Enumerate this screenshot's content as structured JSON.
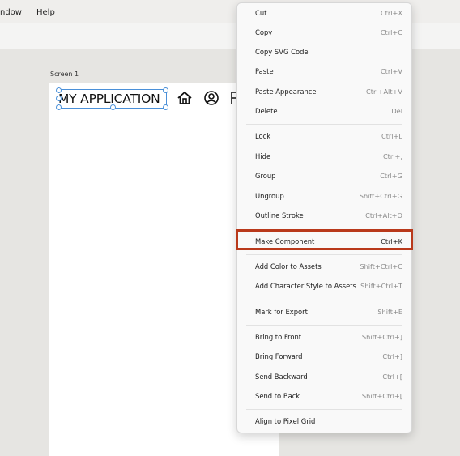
{
  "menubar": {
    "window_label": "ndow",
    "help_label": "Help"
  },
  "artboard": {
    "name": "Screen 1"
  },
  "header": {
    "title": "MY APPLICATION",
    "icons": [
      "home-icon",
      "user-circle-icon",
      "partial-icon"
    ]
  },
  "context_menu": {
    "items": [
      {
        "label": "Cut",
        "shortcut": "Ctrl+X"
      },
      {
        "label": "Copy",
        "shortcut": "Ctrl+C"
      },
      {
        "label": "Copy SVG Code",
        "shortcut": ""
      },
      {
        "label": "Paste",
        "shortcut": "Ctrl+V"
      },
      {
        "label": "Paste Appearance",
        "shortcut": "Ctrl+Alt+V"
      },
      {
        "label": "Delete",
        "shortcut": "Del"
      },
      {
        "label": "Lock",
        "shortcut": "Ctrl+L"
      },
      {
        "label": "Hide",
        "shortcut": "Ctrl+,"
      },
      {
        "label": "Group",
        "shortcut": "Ctrl+G"
      },
      {
        "label": "Ungroup",
        "shortcut": "Shift+Ctrl+G"
      },
      {
        "label": "Outline Stroke",
        "shortcut": "Ctrl+Alt+O"
      },
      {
        "label": "Make Component",
        "shortcut": "Ctrl+K"
      },
      {
        "label": "Add Color to Assets",
        "shortcut": "Shift+Ctrl+C"
      },
      {
        "label": "Add Character Style to Assets",
        "shortcut": "Shift+Ctrl+T"
      },
      {
        "label": "Mark for Export",
        "shortcut": "Shift+E"
      },
      {
        "label": "Bring to Front",
        "shortcut": "Shift+Ctrl+]"
      },
      {
        "label": "Bring Forward",
        "shortcut": "Ctrl+]"
      },
      {
        "label": "Send Backward",
        "shortcut": "Ctrl+["
      },
      {
        "label": "Send to Back",
        "shortcut": "Shift+Ctrl+["
      },
      {
        "label": "Align to Pixel Grid",
        "shortcut": ""
      }
    ],
    "highlighted": "Make Component",
    "highlight_color": "#b9391b",
    "selection_color": "#4a90d9"
  }
}
